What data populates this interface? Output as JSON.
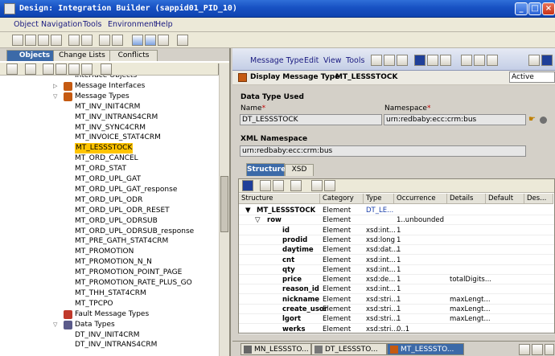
{
  "window": {
    "title": "Design: Integration Builder (sappid01_PID_10)"
  },
  "menubar": {
    "items": [
      "Object",
      "Navigation",
      "Tools",
      "Environment",
      "Help"
    ]
  },
  "left": {
    "tabs": [
      "Objects",
      "Change Lists",
      "Conflicts"
    ],
    "tree": [
      {
        "label": "Interface Objects",
        "level": 1,
        "type": "folder",
        "cut": true
      },
      {
        "label": "Message Interfaces",
        "level": 2,
        "type": "msgint",
        "expand": "+"
      },
      {
        "label": "Message Types",
        "level": 2,
        "type": "msgtype",
        "expand": "-"
      },
      {
        "label": "MT_INV_INIT4CRM",
        "level": 3
      },
      {
        "label": "MT_INV_INTRANS4CRM",
        "level": 3
      },
      {
        "label": "MT_INV_SYNC4CRM",
        "level": 3
      },
      {
        "label": "MT_INVOICE_STAT4CRM",
        "level": 3
      },
      {
        "label": "MT_LESSSTOCK",
        "level": 3,
        "selected": true
      },
      {
        "label": "MT_ORD_CANCEL",
        "level": 3
      },
      {
        "label": "MT_ORD_STAT",
        "level": 3
      },
      {
        "label": "MT_ORD_UPL_GAT",
        "level": 3
      },
      {
        "label": "MT_ORD_UPL_GAT_response",
        "level": 3
      },
      {
        "label": "MT_ORD_UPL_ODR",
        "level": 3
      },
      {
        "label": "MT_ORD_UPL_ODR_RESET",
        "level": 3
      },
      {
        "label": "MT_ORD_UPL_ODRSUB",
        "level": 3
      },
      {
        "label": "MT_ORD_UPL_ODRSUB_response",
        "level": 3
      },
      {
        "label": "MT_PRE_GATH_STAT4CRM",
        "level": 3
      },
      {
        "label": "MT_PROMOTION",
        "level": 3
      },
      {
        "label": "MT_PROMOTION_N_N",
        "level": 3
      },
      {
        "label": "MT_PROMOTION_POINT_PAGE",
        "level": 3
      },
      {
        "label": "MT_PROMOTION_RATE_PLUS_GO",
        "level": 3
      },
      {
        "label": "MT_THH_STAT4CRM",
        "level": 3
      },
      {
        "label": "MT_TPCPO",
        "level": 3
      },
      {
        "label": "Fault Message Types",
        "level": 2,
        "type": "fault",
        "expand": ""
      },
      {
        "label": "Data Types",
        "level": 2,
        "type": "dtype",
        "expand": "-"
      },
      {
        "label": "DT_INV_INIT4CRM",
        "level": 3
      },
      {
        "label": "DT_INV_INTRANS4CRM",
        "level": 3
      }
    ]
  },
  "right": {
    "menu": [
      "Message Type",
      "Edit",
      "View",
      "Tools"
    ],
    "header_title": "Display Message Type",
    "header_object": "MT_LESSSTOCK",
    "status": "Active",
    "section_label": "Data Type Used",
    "name_label": "Name",
    "name_value": "DT_LESSSTOCK",
    "namespace_label": "Namespace",
    "namespace_value": "urn:redbaby:ecc:crm:bus",
    "xml_ns_label": "XML Namespace",
    "xml_ns_value": "urn:redbaby:ecc:crm:bus",
    "tabs": [
      "Structure",
      "XSD"
    ],
    "columns": [
      "Structure",
      "Category",
      "Type",
      "Occurrence",
      "Details",
      "Default",
      "Des..."
    ],
    "rows": [
      {
        "name": "MT_LESSSTOCK",
        "category": "Element",
        "type": "DT_LE...",
        "occ": "",
        "details": "",
        "level": 0,
        "toggle": "▼"
      },
      {
        "name": "row",
        "category": "Element",
        "type": "",
        "occ": "1..unbounded",
        "details": "",
        "level": 1,
        "toggle": "▽"
      },
      {
        "name": "id",
        "category": "Element",
        "type": "xsd:int...",
        "occ": "1",
        "details": "",
        "level": 2
      },
      {
        "name": "prodid",
        "category": "Element",
        "type": "xsd:long",
        "occ": "1",
        "details": "",
        "level": 2
      },
      {
        "name": "daytime",
        "category": "Element",
        "type": "xsd:dat...",
        "occ": "1",
        "details": "",
        "level": 2
      },
      {
        "name": "cnt",
        "category": "Element",
        "type": "xsd:int...",
        "occ": "1",
        "details": "",
        "level": 2
      },
      {
        "name": "qty",
        "category": "Element",
        "type": "xsd:int...",
        "occ": "1",
        "details": "",
        "level": 2
      },
      {
        "name": "price",
        "category": "Element",
        "type": "xsd:de...",
        "occ": "1",
        "details": "totalDigits...",
        "level": 2
      },
      {
        "name": "reason_id",
        "category": "Element",
        "type": "xsd:int...",
        "occ": "1",
        "details": "",
        "level": 2
      },
      {
        "name": "nickname",
        "category": "Element",
        "type": "xsd:stri...",
        "occ": "1",
        "details": "maxLengt...",
        "level": 2
      },
      {
        "name": "create_usor",
        "category": "Element",
        "type": "xsd:stri...",
        "occ": "1",
        "details": "maxLengt...",
        "level": 2
      },
      {
        "name": "lgort",
        "category": "Element",
        "type": "xsd:stri...",
        "occ": "1",
        "details": "maxLengt...",
        "level": 2
      },
      {
        "name": "werks",
        "category": "Element",
        "type": "xsd:stri...",
        "occ": "0..1",
        "details": "",
        "level": 2
      }
    ],
    "bottom_tabs": [
      "MN_LESSSTO...",
      "DT_LESSSTO...",
      "MT_LESSSTO..."
    ]
  },
  "colors": {
    "title_bar": "#1851c3",
    "selection": "#ffc400",
    "active_tab": "#3c6aa8",
    "link_text": "#1a1a80",
    "field_bg": "#e6e6e6"
  }
}
